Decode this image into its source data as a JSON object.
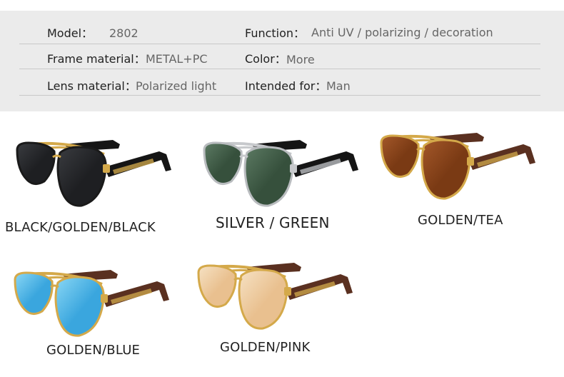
{
  "specs": {
    "model_label": "Model：",
    "model_value": "2802",
    "function_label": "Function：",
    "function_value": "Anti UV / polarizing / decoration",
    "frame_label": "Frame material：",
    "frame_value": "METAL+PC",
    "color_label": "Color：",
    "color_value": "More",
    "lens_label": "Lens material：",
    "lens_value": "Polarized light",
    "intended_label": "Intended for：",
    "intended_value": "Man"
  },
  "products": [
    {
      "caption": "BLACK/GOLDEN/BLACK",
      "lens_color": "#1e1f22",
      "lens_highlight": "#3a3c40",
      "frame_color": "#1a1a1a",
      "bridge_color": "#d4a94a",
      "temple_color": "#151515",
      "temple_accent": "#c9a24a"
    },
    {
      "caption": "SILVER / GREEN",
      "lens_color": "#36503c",
      "lens_highlight": "#5c7a63",
      "frame_color": "#b9bcbf",
      "bridge_color": "#c7c9cc",
      "temple_color": "#151515",
      "temple_accent": "#b9bcbf"
    },
    {
      "caption": "GOLDEN/TEA",
      "lens_color": "#7a3a14",
      "lens_highlight": "#a4582a",
      "frame_color": "#d4a94a",
      "bridge_color": "#d4a94a",
      "temple_color": "#5a3020",
      "temple_accent": "#c9a24a"
    },
    {
      "caption": "GOLDEN/BLUE",
      "lens_color": "#3aa6de",
      "lens_highlight": "#8ad7f5",
      "frame_color": "#d4a94a",
      "bridge_color": "#d4a94a",
      "temple_color": "#5a3020",
      "temple_accent": "#c9a24a"
    },
    {
      "caption": "GOLDEN/PINK",
      "lens_color": "#e9c08f",
      "lens_highlight": "#f6e2c4",
      "frame_color": "#d4a94a",
      "bridge_color": "#d4a94a",
      "temple_color": "#5a3020",
      "temple_accent": "#c9a24a"
    }
  ]
}
